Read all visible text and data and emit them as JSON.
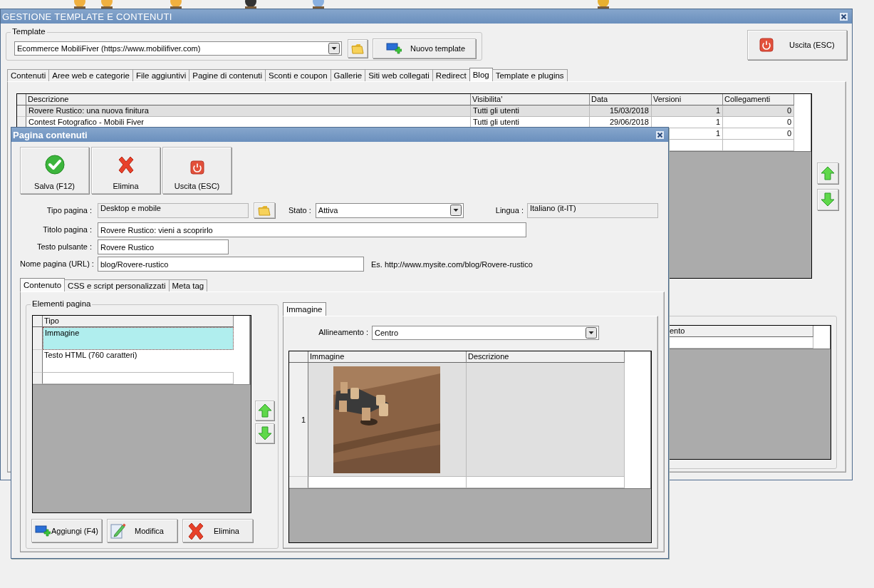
{
  "main_window": {
    "title": "GESTIONE TEMPLATE E CONTENUTI",
    "template_group": {
      "label": "Template",
      "combo_value": "Ecommerce MobiliFiver (https://www.mobilifiver.com)",
      "new_button": "Nuovo template"
    },
    "exit_button": "Uscita (ESC)",
    "tabs": [
      {
        "label": "Contenuti",
        "selected": false
      },
      {
        "label": "Aree web e categorie",
        "selected": false
      },
      {
        "label": "File aggiuntivi",
        "selected": false
      },
      {
        "label": "Pagine di contenuti",
        "selected": false
      },
      {
        "label": "Sconti e coupon",
        "selected": false
      },
      {
        "label": "Gallerie",
        "selected": false
      },
      {
        "label": "Siti web collegati",
        "selected": false
      },
      {
        "label": "Redirect",
        "selected": false
      },
      {
        "label": "Blog",
        "selected": true
      },
      {
        "label": "Template e plugins",
        "selected": false
      }
    ],
    "table": {
      "columns": [
        "Descrizione",
        "Visibilita'",
        "Data",
        "Versioni",
        "Collegamenti"
      ],
      "rows": [
        {
          "cells": [
            "Rovere Rustico: una nuova finitura",
            "Tutti gli utenti",
            "15/03/2018",
            "1",
            "0"
          ],
          "selected": true
        },
        {
          "cells": [
            "Contest Fotografico - Mobili Fiver",
            "Tutti gli utenti",
            "29/06/2018",
            "1",
            "0"
          ],
          "selected": false
        },
        {
          "cells": [
            null,
            null,
            null,
            "1",
            "0"
          ],
          "selected": false
        }
      ]
    },
    "side_table": {
      "columns": [
        "ento"
      ]
    }
  },
  "dialog": {
    "title": "Pagina contenuti",
    "toolbar": [
      {
        "label": "Salva (F12)",
        "kind": "save"
      },
      {
        "label": "Elimina",
        "kind": "delete"
      },
      {
        "label": "Uscita (ESC)",
        "kind": "exit"
      }
    ],
    "tipo_pagina": {
      "label": "Tipo pagina :",
      "value": "Desktop e mobile"
    },
    "stato": {
      "label": "Stato :",
      "value": "Attiva"
    },
    "lingua": {
      "label": "Lingua :",
      "value": "Italiano (it-IT)"
    },
    "titolo_pagina": {
      "label": "Titolo pagina :",
      "value": "Rovere Rustico: vieni a scoprirlo"
    },
    "testo_pulsante": {
      "label": "Testo pulsante :",
      "value": "Rovere Rustico"
    },
    "nome_pagina": {
      "label": "Nome pagina (URL) :",
      "value": "blog/Rovere-rustico",
      "hint": "Es. http://www.mysite.com/blog/Rovere-rustico"
    },
    "tabs": [
      {
        "label": "Contenuto",
        "selected": true
      },
      {
        "label": "CSS e script personalizzati",
        "selected": false
      },
      {
        "label": "Meta tag",
        "selected": false
      }
    ],
    "elements_group": {
      "label": "Elementi pagina",
      "columns": [
        "Tipo"
      ],
      "rows": [
        {
          "tipo": "Immagine",
          "selected": true
        },
        {
          "tipo": "Testo HTML (760 caratteri)",
          "selected": false
        }
      ],
      "buttons": [
        {
          "label": "Aggiungi (F4)",
          "kind": "add"
        },
        {
          "label": "Modifica",
          "kind": "edit"
        },
        {
          "label": "Elimina",
          "kind": "delete"
        }
      ]
    },
    "detail_tabs": [
      {
        "label": "Immagine",
        "selected": true
      }
    ],
    "alignment": {
      "label": "Allineamento :",
      "value": "Centro"
    },
    "image_table": {
      "columns": [
        "Immagine",
        "Descrizione"
      ],
      "rows": [
        {
          "number": "1"
        }
      ]
    }
  }
}
